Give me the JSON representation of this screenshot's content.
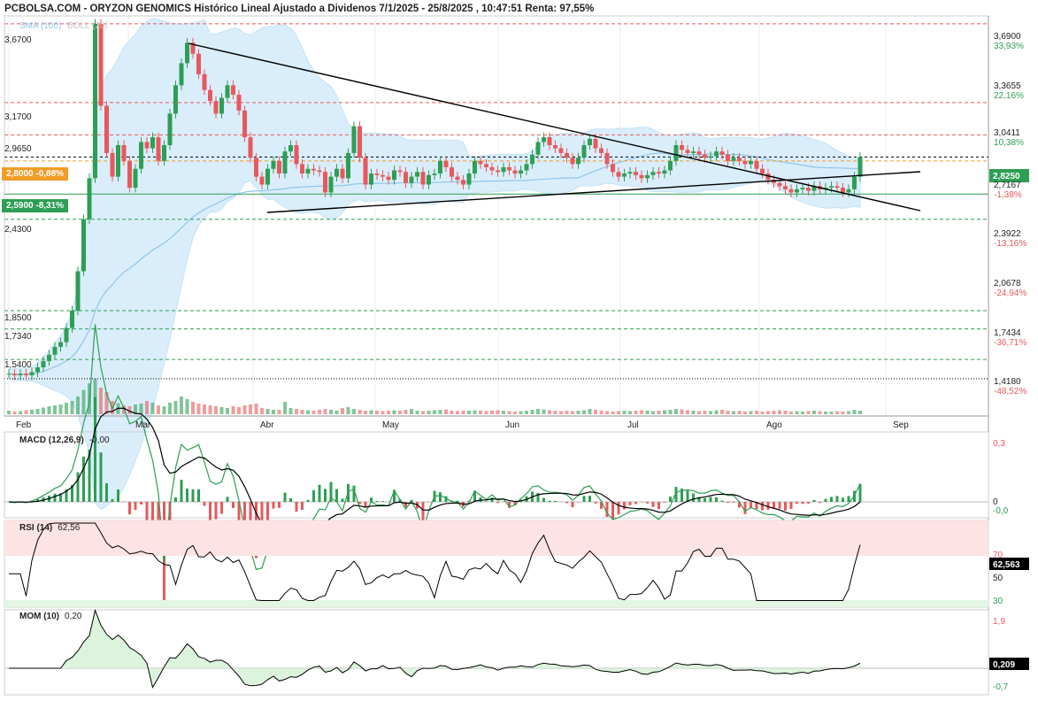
{
  "header": {
    "title": "PCBOLSA.COM - ORYZON GENOMICS Histórico Lineal Ajustado a Dividenos 7/1/2025 - 25/8/2025 , 10:47:51 Renta: 97,55%",
    "legend_sma": "SMA (100)",
    "legend_boll": "BOLL (20)"
  },
  "colors": {
    "up": "#2e9e55",
    "down": "#e8585c",
    "sma": "#8fc6ea",
    "boll_fill": "#d6ecfa",
    "badge_orange": "#f39c27",
    "badge_green": "#2e9e55",
    "trend_line": "#000000"
  },
  "left_labels": [
    "3,6700",
    "3,1700",
    "2,9650",
    "2,4300",
    "1,8500",
    "1,7340",
    "1,5400"
  ],
  "badges": {
    "orange": "2,8000 -0,88%",
    "green": "2,5900 -8,31%"
  },
  "right_axis": [
    {
      "price": "3,6900",
      "pct": "33,93%",
      "dir": "up"
    },
    {
      "price": "3,3655",
      "pct": "22,16%",
      "dir": "up"
    },
    {
      "price": "3,0411",
      "pct": "10,38%",
      "dir": "up"
    },
    {
      "price": "2,8250",
      "pct": "",
      "dir": "cur"
    },
    {
      "price": "2,7167",
      "pct": "-1,38%",
      "dir": "down"
    },
    {
      "price": "2,3922",
      "pct": "-13,16%",
      "dir": "down"
    },
    {
      "price": "2,0678",
      "pct": "-24,94%",
      "dir": "down"
    },
    {
      "price": "1,7434",
      "pct": "-36,71%",
      "dir": "down"
    },
    {
      "price": "1,4180",
      "pct": "-48,52%",
      "dir": "down"
    }
  ],
  "months": [
    "Feb",
    "Mar",
    "Abr",
    "May",
    "Jun",
    "Jul",
    "Ago",
    "Sep"
  ],
  "panels": {
    "macd": {
      "name": "MACD (12,26,9)",
      "value": "-0,00",
      "axis": [
        "0,3",
        "0",
        "-0,0"
      ]
    },
    "rsi": {
      "name": "RSI (14)",
      "value": "62,56",
      "axis": [
        "70",
        "50",
        "30"
      ],
      "badge": "62,563"
    },
    "mom": {
      "name": "MOM (10)",
      "value": "0,20",
      "axis": [
        "1,9",
        "-0,7"
      ],
      "badge": "0,209"
    }
  },
  "chart_data": [
    {
      "type": "candlestick",
      "title": "ORYZON GENOMICS",
      "period": "7/1/2025 - 25/8/2025",
      "x_months": [
        "Feb",
        "Mar",
        "Abr",
        "May",
        "Jun",
        "Jul",
        "Ago",
        "Sep"
      ],
      "y_range": [
        1.35,
        3.72
      ],
      "horizontal_levels": [
        3.67,
        3.17,
        2.965,
        2.8,
        2.59,
        2.43,
        1.85,
        1.734,
        1.54,
        1.418
      ],
      "current_price": 2.825,
      "close_series": [
        1.45,
        1.44,
        1.45,
        1.44,
        1.46,
        1.49,
        1.53,
        1.57,
        1.62,
        1.65,
        1.74,
        1.85,
        2.1,
        2.43,
        2.69,
        3.67,
        3.15,
        2.85,
        2.7,
        2.9,
        2.8,
        2.63,
        2.75,
        2.92,
        2.88,
        2.95,
        2.8,
        2.9,
        3.1,
        3.28,
        3.42,
        3.55,
        3.48,
        3.35,
        3.25,
        3.18,
        3.1,
        3.2,
        3.28,
        3.22,
        3.12,
        2.95,
        2.82,
        2.7,
        2.65,
        2.75,
        2.8,
        2.72,
        2.86,
        2.9,
        2.78,
        2.72,
        2.75,
        2.74,
        2.73,
        2.6,
        2.7,
        2.75,
        2.69,
        2.85,
        3.02,
        2.82,
        2.65,
        2.72,
        2.71,
        2.7,
        2.68,
        2.74,
        2.73,
        2.66,
        2.7,
        2.73,
        2.65,
        2.71,
        2.72,
        2.8,
        2.76,
        2.7,
        2.68,
        2.65,
        2.72,
        2.8,
        2.78,
        2.76,
        2.74,
        2.73,
        2.76,
        2.74,
        2.72,
        2.74,
        2.78,
        2.84,
        2.92,
        2.95,
        2.9,
        2.88,
        2.85,
        2.82,
        2.78,
        2.82,
        2.9,
        2.94,
        2.88,
        2.85,
        2.78,
        2.73,
        2.7,
        2.72,
        2.73,
        2.71,
        2.69,
        2.71,
        2.73,
        2.72,
        2.74,
        2.8,
        2.9,
        2.87,
        2.85,
        2.86,
        2.84,
        2.82,
        2.83,
        2.86,
        2.84,
        2.8,
        2.82,
        2.8,
        2.78,
        2.8,
        2.75,
        2.72,
        2.68,
        2.66,
        2.64,
        2.62,
        2.6,
        2.62,
        2.63,
        2.61,
        2.64,
        2.62,
        2.63,
        2.64,
        2.63,
        2.6,
        2.62,
        2.7,
        2.825
      ],
      "volume_series": [
        8,
        6,
        7,
        9,
        10,
        12,
        15,
        18,
        20,
        22,
        26,
        30,
        40,
        55,
        70,
        80,
        60,
        50,
        30,
        25,
        20,
        18,
        22,
        24,
        30,
        26,
        20,
        18,
        26,
        30,
        40,
        34,
        28,
        24,
        22,
        20,
        18,
        16,
        14,
        18,
        16,
        20,
        22,
        24,
        14,
        12,
        10,
        10,
        28,
        14,
        12,
        10,
        9,
        8,
        10,
        12,
        10,
        8,
        14,
        16,
        12,
        10,
        8,
        9,
        8,
        7,
        8,
        9,
        8,
        10,
        12,
        8,
        7,
        8,
        9,
        10,
        11,
        8,
        7,
        8,
        8,
        9,
        8,
        7,
        8,
        9,
        8,
        7,
        6,
        7,
        8,
        10,
        12,
        11,
        9,
        8,
        7,
        8,
        7,
        8,
        9,
        12,
        10,
        8,
        7,
        6,
        7,
        8,
        7,
        8,
        9,
        8,
        7,
        8,
        9,
        10,
        12,
        11,
        9,
        8,
        7,
        8,
        7,
        9,
        10,
        8,
        7,
        8,
        6,
        7,
        8,
        6,
        7,
        8,
        9,
        8,
        6,
        7,
        6,
        7,
        8,
        7,
        6,
        6,
        7,
        6,
        7,
        10,
        8
      ]
    },
    {
      "type": "line",
      "title": "MACD (12,26,9)",
      "last_value": -0.0,
      "ylim": [
        -0.05,
        0.3
      ]
    },
    {
      "type": "line",
      "title": "RSI (14)",
      "last_value": 62.563,
      "ylim": [
        30,
        90
      ],
      "levels": [
        70,
        50,
        30
      ]
    },
    {
      "type": "line",
      "title": "MOM (10)",
      "last_value": 0.209,
      "ylim": [
        -0.7,
        1.9
      ]
    }
  ]
}
